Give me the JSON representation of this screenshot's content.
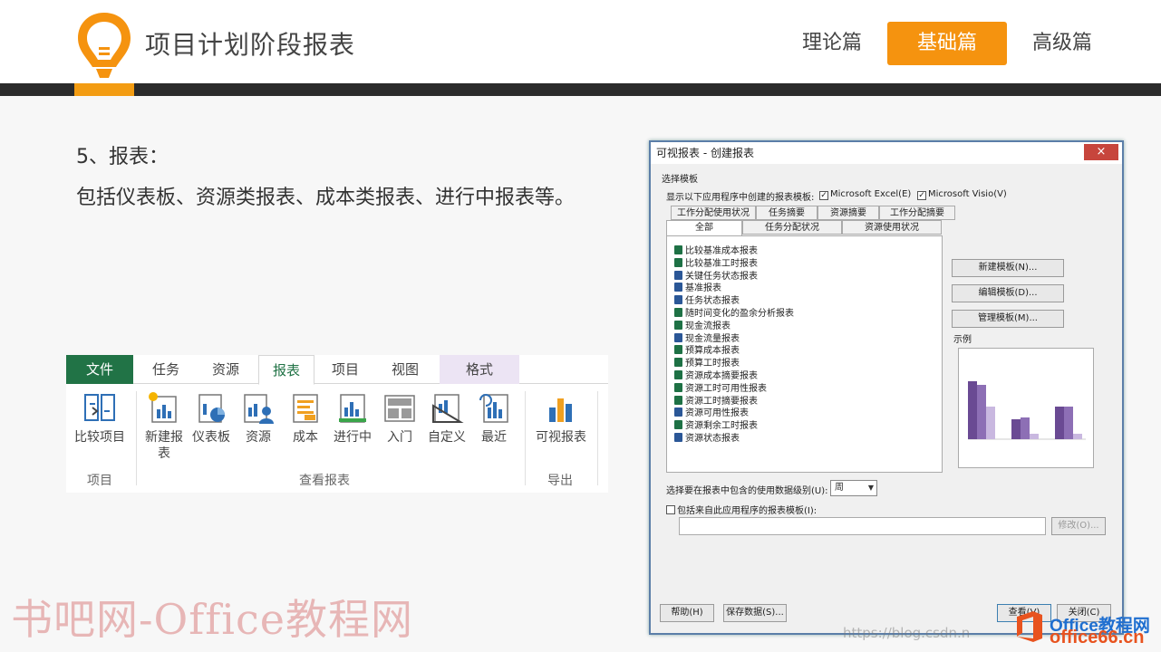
{
  "header": {
    "title": "项目计划阶段报表",
    "nav": [
      "理论篇",
      "基础篇",
      "高级篇"
    ],
    "active_nav": "基础篇",
    "accent_color": "#f5930f"
  },
  "content": {
    "line1": "5、报表：",
    "line2": "包括仪表板、资源类报表、成本类报表、进行中报表等。"
  },
  "ribbon": {
    "tabs": [
      "文件",
      "任务",
      "资源",
      "报表",
      "项目",
      "视图",
      "格式"
    ],
    "selected_tab": "报表",
    "buttons": [
      {
        "label": "比较项目",
        "icon": "compare-projects-icon"
      },
      {
        "label": "新建报表",
        "icon": "new-report-icon"
      },
      {
        "label": "仪表板",
        "icon": "dashboards-icon"
      },
      {
        "label": "资源",
        "icon": "resources-report-icon"
      },
      {
        "label": "成本",
        "icon": "costs-report-icon"
      },
      {
        "label": "进行中",
        "icon": "in-progress-report-icon"
      },
      {
        "label": "入门",
        "icon": "getting-started-icon"
      },
      {
        "label": "自定义",
        "icon": "custom-report-icon"
      },
      {
        "label": "最近",
        "icon": "recent-report-icon"
      },
      {
        "label": "可视报表",
        "icon": "visual-reports-icon"
      }
    ],
    "groups": [
      "项目",
      "查看报表",
      "导出"
    ]
  },
  "dialog": {
    "title": "可视报表 - 创建报表",
    "close": "×",
    "section": "选择模板",
    "show_templates_label": "显示以下应用程序中创建的报表模板:",
    "excel_label": "Microsoft Excel(E)",
    "visio_label": "Microsoft Visio(V)",
    "tabs_back": [
      "工作分配使用状况",
      "任务摘要",
      "资源摘要",
      "工作分配摘要"
    ],
    "tabs_front": [
      "全部",
      "任务分配状况",
      "资源使用状况"
    ],
    "templates": [
      {
        "name": "比较基准成本报表",
        "app": "excel"
      },
      {
        "name": "比较基准工时报表",
        "app": "excel"
      },
      {
        "name": "关键任务状态报表",
        "app": "visio"
      },
      {
        "name": "基准报表",
        "app": "visio"
      },
      {
        "name": "任务状态报表",
        "app": "visio"
      },
      {
        "name": "随时间变化的盈余分析报表",
        "app": "excel"
      },
      {
        "name": "现金流报表",
        "app": "excel"
      },
      {
        "name": "现金流量报表",
        "app": "visio"
      },
      {
        "name": "预算成本报表",
        "app": "excel"
      },
      {
        "name": "预算工时报表",
        "app": "excel"
      },
      {
        "name": "资源成本摘要报表",
        "app": "excel"
      },
      {
        "name": "资源工时可用性报表",
        "app": "excel"
      },
      {
        "name": "资源工时摘要报表",
        "app": "excel"
      },
      {
        "name": "资源可用性报表",
        "app": "visio"
      },
      {
        "name": "资源剩余工时报表",
        "app": "excel"
      },
      {
        "name": "资源状态报表",
        "app": "visio"
      }
    ],
    "new_template": "新建模板(N)...",
    "edit_template": "编辑模板(D)...",
    "manage_template": "管理模板(M)...",
    "sample_label": "示例",
    "usage_level_label": "选择要在报表中包含的使用数据级别(U):",
    "usage_level_value": "周",
    "include_label": "包括来自此应用程序的报表模板(I):",
    "modify": "修改(O)...",
    "help": "帮助(H)",
    "save_data": "保存数据(S)...",
    "view": "查看(V)",
    "close_btn": "关闭(C)"
  },
  "watermarks": {
    "left": "书吧网-Office教程网",
    "url": "https://blog.csdn.n",
    "right_line1": "Office教程网",
    "right_line2": "office66.cn"
  }
}
